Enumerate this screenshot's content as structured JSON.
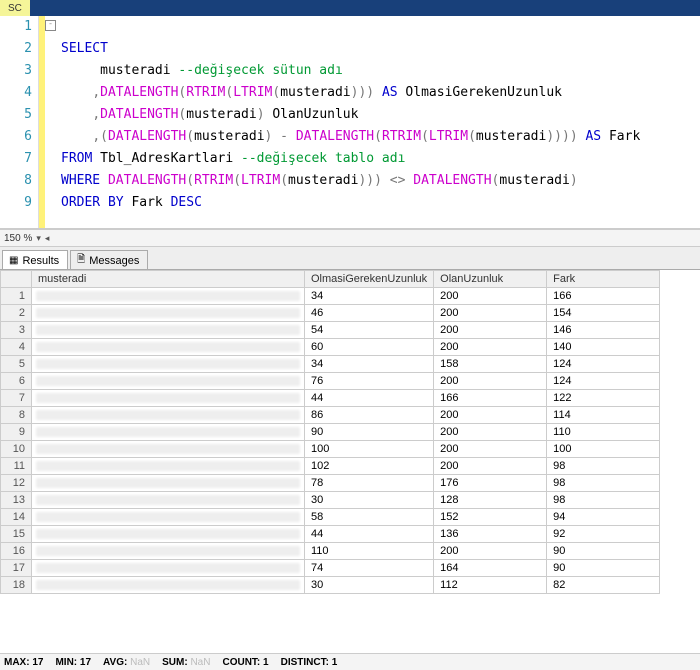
{
  "title_tab": "SC",
  "zoom_label": "150 %",
  "tabs": {
    "results": "Results",
    "messages": "Messages"
  },
  "columns": [
    "musteradi",
    "OlmasiGerekenUzunluk",
    "OlanUzunluk",
    "Fark"
  ],
  "code": {
    "l1": {
      "kw": "SELECT"
    },
    "l2": {
      "ident": "musteradi",
      "cmt": " --değişecek sütun adı"
    },
    "l3": {
      "p": ",",
      "fn1": "DATALENGTH",
      "fn2": "RTRIM",
      "fn3": "LTRIM",
      "arg": "musteradi",
      "as": " AS",
      "alias": " OlmasiGerekenUzunluk"
    },
    "l4": {
      "p": ",",
      "fn1": "DATALENGTH",
      "arg": "musteradi",
      "alias": " OlanUzunluk"
    },
    "l5": {
      "p": ",",
      "fn1": "DATALENGTH",
      "arg1": "musteradi",
      "minus": " -",
      "fn2": "DATALENGTH",
      "fn3": "RTRIM",
      "fn4": "LTRIM",
      "arg2": "musteradi",
      "as": " AS",
      "alias": " Fark"
    },
    "l6": {
      "kw": "FROM",
      "tbl": " Tbl_AdresKartlari",
      "cmt": " --değişecek tablo adı"
    },
    "l7": {
      "kw": "WHERE",
      "fn1": "DATALENGTH",
      "fn2": "RTRIM",
      "fn3": "LTRIM",
      "arg1": "musteradi",
      "op": " <>",
      "fn4": "DATALENGTH",
      "arg2": "musteradi"
    },
    "l8": {
      "kw": "ORDER BY",
      "col": " Fark",
      "dir": " DESC"
    }
  },
  "line_numbers": [
    "1",
    "2",
    "3",
    "4",
    "5",
    "6",
    "7",
    "8",
    "9"
  ],
  "rows": [
    {
      "n": "1",
      "a": "34",
      "b": "200",
      "c": "166"
    },
    {
      "n": "2",
      "a": "46",
      "b": "200",
      "c": "154"
    },
    {
      "n": "3",
      "a": "54",
      "b": "200",
      "c": "146"
    },
    {
      "n": "4",
      "a": "60",
      "b": "200",
      "c": "140"
    },
    {
      "n": "5",
      "a": "34",
      "b": "158",
      "c": "124"
    },
    {
      "n": "6",
      "a": "76",
      "b": "200",
      "c": "124"
    },
    {
      "n": "7",
      "a": "44",
      "b": "166",
      "c": "122"
    },
    {
      "n": "8",
      "a": "86",
      "b": "200",
      "c": "114"
    },
    {
      "n": "9",
      "a": "90",
      "b": "200",
      "c": "110"
    },
    {
      "n": "10",
      "a": "100",
      "b": "200",
      "c": "100"
    },
    {
      "n": "11",
      "a": "102",
      "b": "200",
      "c": "98"
    },
    {
      "n": "12",
      "a": "78",
      "b": "176",
      "c": "98"
    },
    {
      "n": "13",
      "a": "30",
      "b": "128",
      "c": "98"
    },
    {
      "n": "14",
      "a": "58",
      "b": "152",
      "c": "94"
    },
    {
      "n": "15",
      "a": "44",
      "b": "136",
      "c": "92"
    },
    {
      "n": "16",
      "a": "110",
      "b": "200",
      "c": "90"
    },
    {
      "n": "17",
      "a": "74",
      "b": "164",
      "c": "90"
    },
    {
      "n": "18",
      "a": "30",
      "b": "112",
      "c": "82"
    }
  ],
  "status": {
    "max_lbl": "MAX:",
    "max_val": "17",
    "min_lbl": "MIN:",
    "min_val": "17",
    "avg_lbl": "AVG:",
    "avg_val": "NaN",
    "sum_lbl": "SUM:",
    "sum_val": "NaN",
    "count_lbl": "COUNT:",
    "count_val": "1",
    "distinct_lbl": "DISTINCT:",
    "distinct_val": "1"
  }
}
